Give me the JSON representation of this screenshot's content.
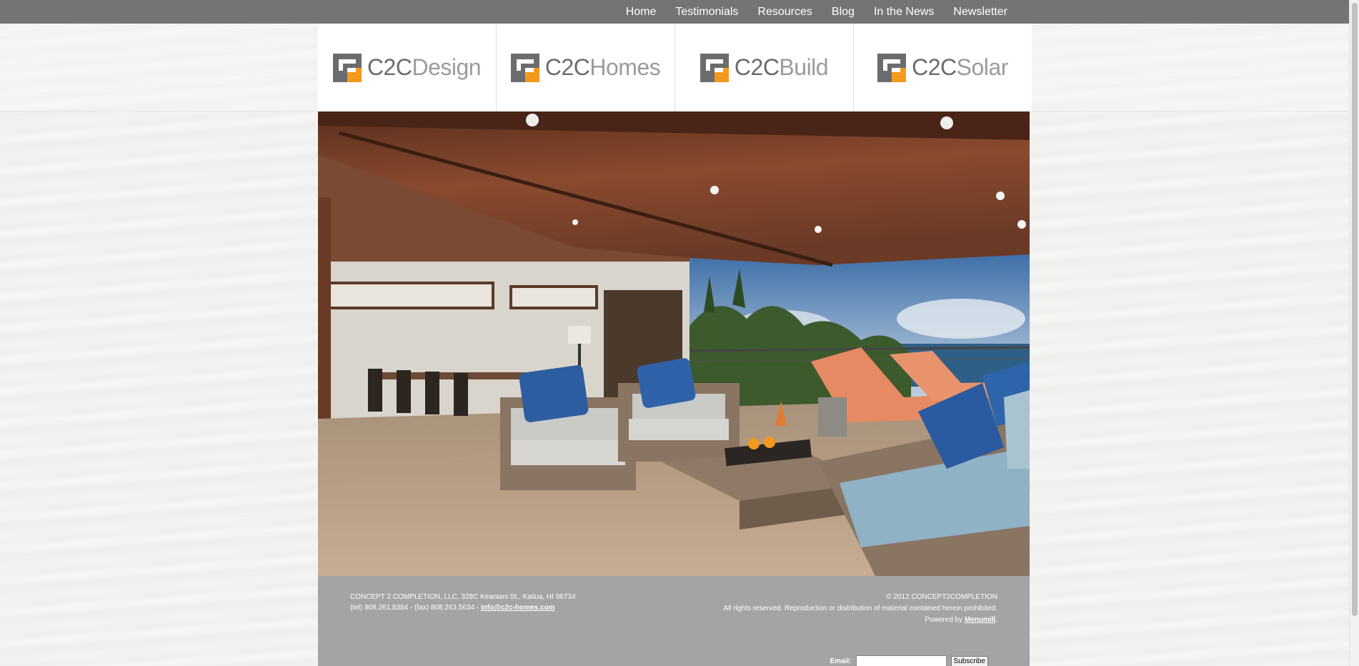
{
  "nav": {
    "items": [
      "Home",
      "Testimonials",
      "Resources",
      "Blog",
      "In the News",
      "Newsletter"
    ]
  },
  "brands": [
    {
      "prefix": "C2C",
      "suffix": "Design"
    },
    {
      "prefix": "C2C",
      "suffix": "Homes"
    },
    {
      "prefix": "C2C",
      "suffix": "Build"
    },
    {
      "prefix": "C2C",
      "suffix": "Solar"
    }
  ],
  "footer": {
    "address": "CONCEPT 2 COMPLETION, LLC, 328C Keaniani St., Kailua, HI 96734",
    "phone_fax": "(tel) 808.261.8384 - (fax) 808.263.5634 - ",
    "email": "info@c2c-homes.com",
    "copyright": "© 2012 CONCEPT2COMPLETION",
    "rights": "All rights reserved. Reproduction or distribution of material contained herein prohibited.",
    "powered_prefix": "Powered by ",
    "powered_link": "Menumill",
    "powered_suffix": ".",
    "email_label": "Email:",
    "subscribe_label": "Subscribe"
  },
  "colors": {
    "topbar": "#737476",
    "logo_gray": "#6b6c6e",
    "logo_orange": "#f39a1e",
    "footer": "#a3a4a6"
  }
}
